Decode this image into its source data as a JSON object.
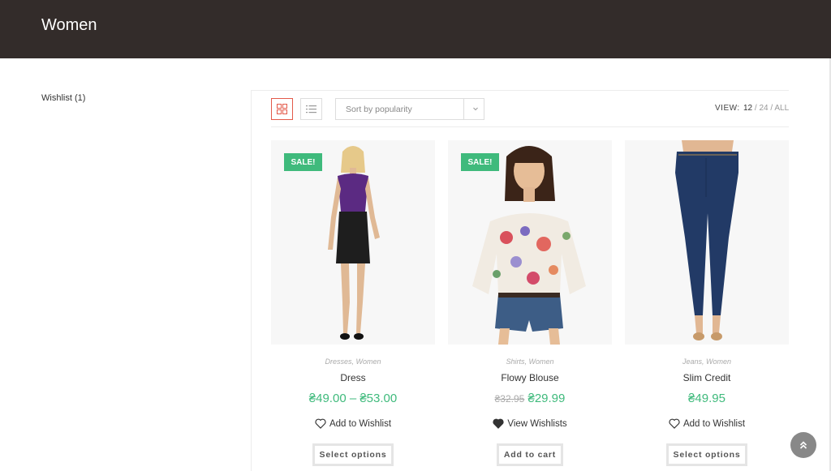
{
  "header": {
    "title": "Women"
  },
  "sidebar": {
    "wishlist_link": "Wishlist (1)"
  },
  "toolbar": {
    "sort_value": "Sort by popularity",
    "view_label": "VIEW:",
    "view_options": [
      "12",
      "24",
      "ALL"
    ],
    "view_current": "12",
    "separator": "/"
  },
  "products": [
    {
      "name": "Dress",
      "categories": [
        "Dresses",
        "Women"
      ],
      "sale": true,
      "price_text": "₴49.00 – ₴53.00",
      "old_price": "",
      "wishlist_label": "Add to Wishlist",
      "wishlisted": false,
      "cta_label": "Select options"
    },
    {
      "name": "Flowy Blouse",
      "categories": [
        "Shirts",
        "Women"
      ],
      "sale": true,
      "price_text": "₴29.99",
      "old_price": "₴32.95",
      "wishlist_label": "View Wishlists",
      "wishlisted": true,
      "cta_label": "Add to cart"
    },
    {
      "name": "Slim Credit",
      "categories": [
        "Jeans",
        "Women"
      ],
      "sale": false,
      "price_text": "₴49.95",
      "old_price": "",
      "wishlist_label": "Add to Wishlist",
      "wishlisted": false,
      "cta_label": "Select options"
    }
  ],
  "badges": {
    "sale_label": "SALE!"
  },
  "colors": {
    "header_bg": "#332c2a",
    "accent_green": "#3fba7c",
    "grid_active": "#e35a4a"
  },
  "icons": {
    "grid_view": "grid-icon",
    "list_view": "list-icon",
    "sort": "chevron-down-icon",
    "wishlist": "heart-icon",
    "scroll_top": "double-chevron-up-icon"
  }
}
